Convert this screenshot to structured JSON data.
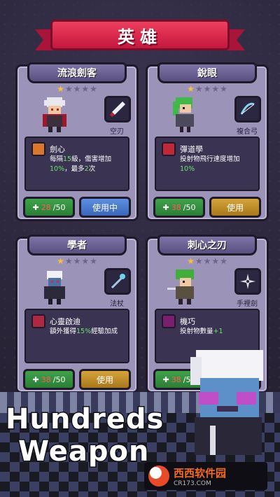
{
  "title": "英雄",
  "cards": [
    {
      "name": "流浪劍客",
      "stars": 1,
      "weapon": "空刃",
      "skill_name": "劍心",
      "skill_desc_parts": [
        "每隔",
        "15",
        "級，傷害增加",
        "10%",
        "，最多",
        "2",
        "次"
      ],
      "count_cur": "28",
      "count_max": "/50",
      "button": "使用中",
      "button_style": "active"
    },
    {
      "name": "銳眼",
      "stars": 1,
      "weapon": "複合弓",
      "skill_name": "彈道學",
      "skill_desc_parts": [
        "投射物飛行速度增加",
        "10%"
      ],
      "count_cur": "38",
      "count_max": "/50",
      "button": "使用",
      "button_style": "gold"
    },
    {
      "name": "學者",
      "stars": 1,
      "weapon": "法杖",
      "skill_name": "心靈啟迪",
      "skill_desc_parts": [
        "額外獲得",
        "15%",
        "經驗加成"
      ],
      "count_cur": "38",
      "count_max": "/50",
      "button": "使用",
      "button_style": "gold"
    },
    {
      "name": "刺心之刃",
      "stars": 1,
      "weapon": "手裡劍",
      "skill_name": "機巧",
      "skill_desc_parts": [
        "投射物數量",
        "+1"
      ],
      "count_cur": "38",
      "count_max": "/50",
      "button": "使用",
      "button_style": "gold"
    }
  ],
  "promo": {
    "line1": "Hundreds",
    "line2": "Weapon"
  },
  "watermark": {
    "brand": "西西软件园",
    "site": "CR173.COM"
  },
  "colors": {
    "banner": "#e0284c",
    "card": "#9c93b8",
    "highlight": "#6fe06f",
    "active_button": "#4a7bd0",
    "gold_button": "#c8922e"
  }
}
